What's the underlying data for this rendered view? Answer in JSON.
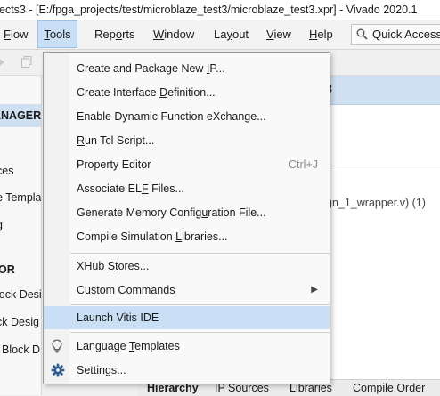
{
  "window": {
    "title": "ects3 - [E:/fpga_projects/test/microblaze_test3/microblaze_test3.xpr] - Vivado 2020.1"
  },
  "menubar": {
    "items": [
      {
        "label_pre": "",
        "mnemonic": "F",
        "label_post": "low"
      },
      {
        "label_pre": "",
        "mnemonic": "T",
        "label_post": "ools"
      },
      {
        "label_pre": "Rep",
        "mnemonic": "o",
        "label_post": "rts"
      },
      {
        "label_pre": "",
        "mnemonic": "W",
        "label_post": "indow"
      },
      {
        "label_pre": "La",
        "mnemonic": "y",
        "label_post": "out"
      },
      {
        "label_pre": "",
        "mnemonic": "V",
        "label_post": "iew"
      },
      {
        "label_pre": "",
        "mnemonic": "H",
        "label_post": "elp"
      }
    ],
    "quick_access": "Quick Access"
  },
  "left_panel": {
    "header": "ANAGER",
    "items": [
      "ces",
      "e Templa",
      "g"
    ],
    "section": "OR",
    "items2": [
      "lock Desi",
      "ck Desig",
      "Block D"
    ]
  },
  "right_panel": {
    "header_text": "3",
    "file_label": "gn_1_wrapper.v) (1)"
  },
  "bottom_tabs": [
    "Hierarchy",
    "IP Sources",
    "Libraries",
    "Compile Order"
  ],
  "tools_menu": {
    "items": [
      {
        "pre": "Create and Package New ",
        "mn": "I",
        "post": "P..."
      },
      {
        "pre": "Create Interface ",
        "mn": "D",
        "post": "efinition..."
      },
      {
        "pre": "Enable Dynamic Function eXchange...",
        "mn": "",
        "post": ""
      },
      {
        "pre": "",
        "mn": "R",
        "post": "un Tcl Script..."
      },
      {
        "pre": "Property Editor",
        "mn": "",
        "post": "",
        "accel": "Ctrl+J"
      },
      {
        "pre": "Associate EL",
        "mn": "F",
        "post": " Files..."
      },
      {
        "pre": "Generate Memory Config",
        "mn": "u",
        "post": "ration File..."
      },
      {
        "pre": "Compile Simulation ",
        "mn": "L",
        "post": "ibraries..."
      },
      {
        "pre": "XHub ",
        "mn": "S",
        "post": "tores..."
      },
      {
        "pre": "C",
        "mn": "u",
        "post": "stom Commands"
      },
      {
        "pre": "Launch Vitis IDE",
        "mn": "",
        "post": ""
      },
      {
        "pre": "Language ",
        "mn": "T",
        "post": "emplates"
      },
      {
        "pre": "Settin",
        "mn": "g",
        "post": "s..."
      }
    ]
  },
  "colors": {
    "highlight": "#c8dff5",
    "header_blue": "#cfe0f3"
  }
}
